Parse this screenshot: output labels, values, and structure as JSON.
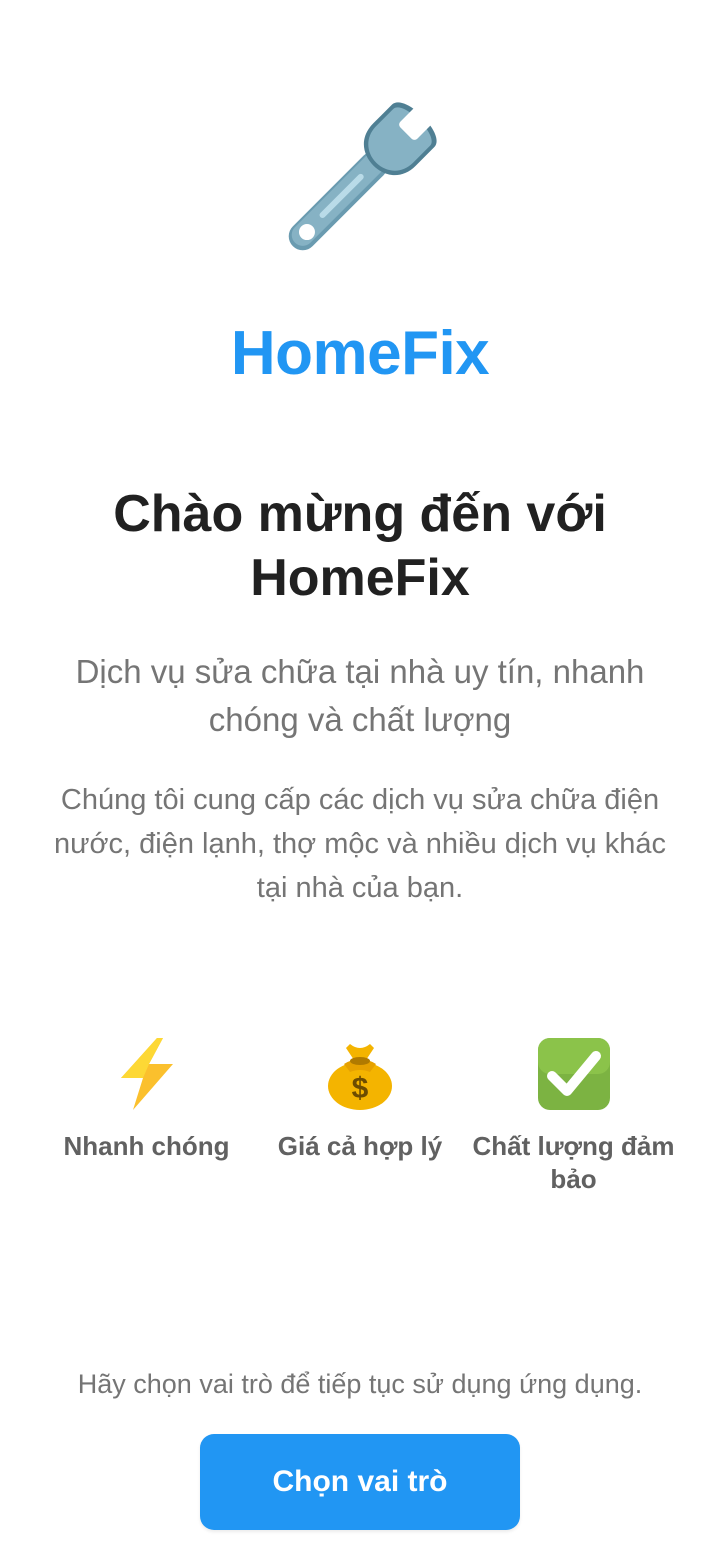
{
  "app": {
    "name": "HomeFix",
    "logo_icon": "wrench-icon",
    "brand_color": "#2196f3"
  },
  "welcome": {
    "title": "Chào mừng đến với HomeFix",
    "tagline": "Dịch vụ sửa chữa tại nhà uy tín, nhanh chóng và chất lượng",
    "description": "Chúng tôi cung cấp các dịch vụ sửa chữa điện nước, điện lạnh, thợ mộc và nhiều dịch vụ khác tại nhà của bạn."
  },
  "features": [
    {
      "icon": "lightning-icon",
      "label": "Nhanh chóng"
    },
    {
      "icon": "money-bag-icon",
      "label": "Giá cả hợp lý"
    },
    {
      "icon": "check-mark-icon",
      "label": "Chất lượng đảm bảo"
    }
  ],
  "footer": {
    "prompt": "Hãy chọn vai trò để tiếp tục sử dụng ứng dụng.",
    "button_label": "Chọn vai trò"
  }
}
